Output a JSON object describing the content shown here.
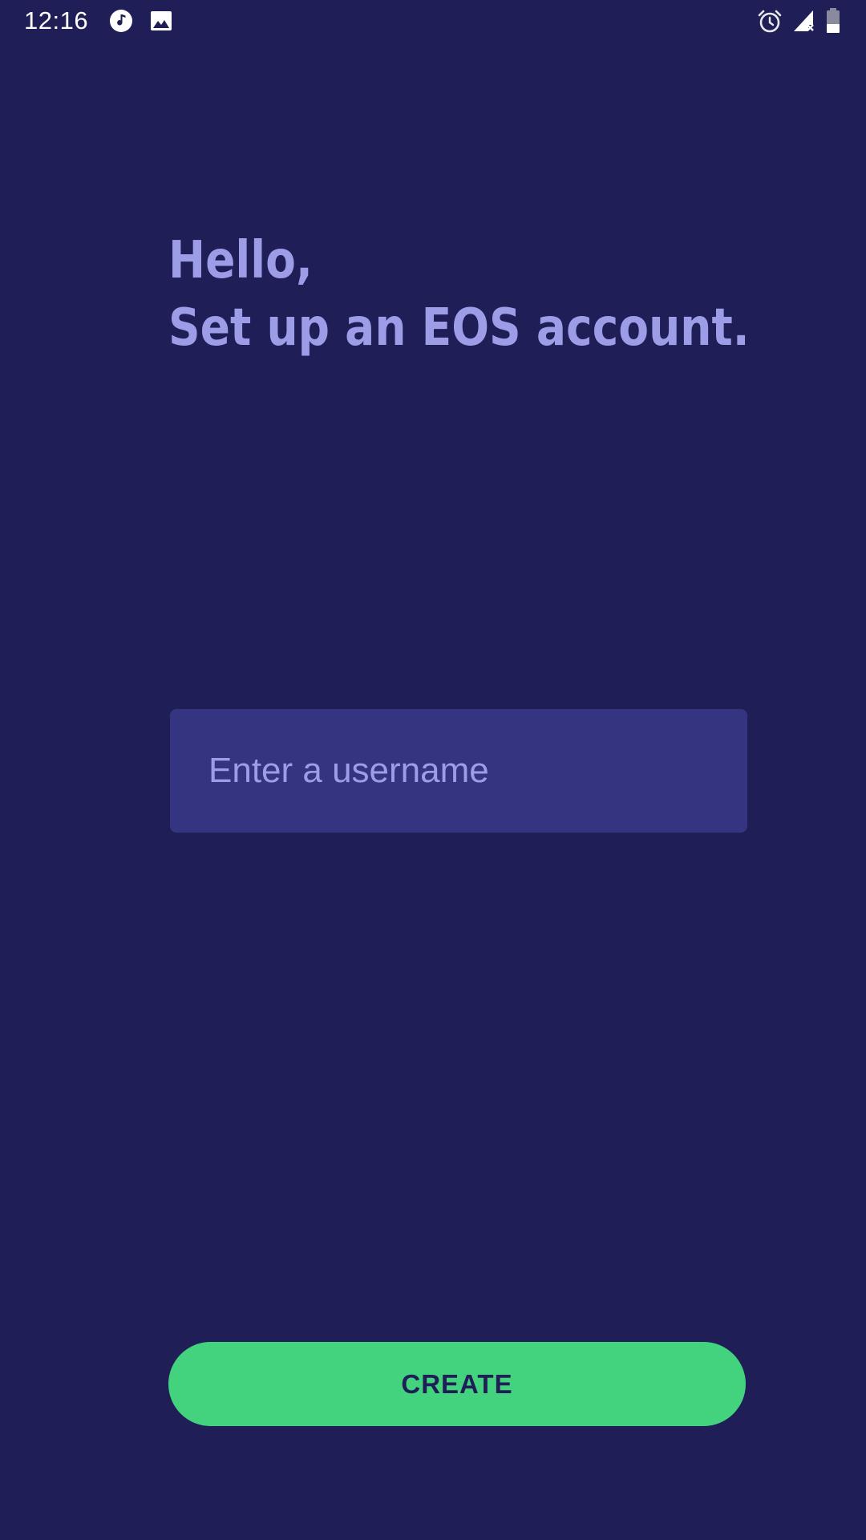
{
  "status_bar": {
    "time": "12:16",
    "icons": [
      "music-note-icon",
      "image-icon",
      "alarm-icon",
      "signal-no-service-icon",
      "battery-icon"
    ]
  },
  "greeting": {
    "line1": "Hello,",
    "line2": "Set up an EOS account."
  },
  "username": {
    "placeholder": "Enter a username",
    "value": ""
  },
  "create_button": {
    "label": "CREATE"
  },
  "colors": {
    "background": "#1f1e56",
    "heading": "#9d9ce7",
    "input_background": "#353480",
    "button": "#43d37e",
    "button_text": "#1f1e56"
  }
}
